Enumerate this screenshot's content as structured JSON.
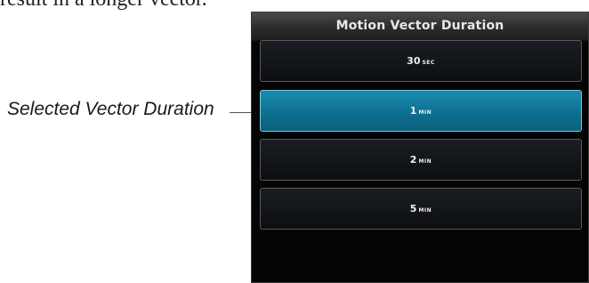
{
  "top_text": "result in a longer vector.",
  "callout": {
    "label": "Selected Vector Duration"
  },
  "panel": {
    "title": "Motion Vector Duration",
    "options": [
      {
        "value": "30",
        "unit": "SEC",
        "selected": false
      },
      {
        "value": "1",
        "unit": "MIN",
        "selected": true
      },
      {
        "value": "2",
        "unit": "MIN",
        "selected": false
      },
      {
        "value": "5",
        "unit": "MIN",
        "selected": false
      }
    ]
  },
  "colors": {
    "selected_fill": "#1a8cae",
    "panel_background": "#050505"
  }
}
